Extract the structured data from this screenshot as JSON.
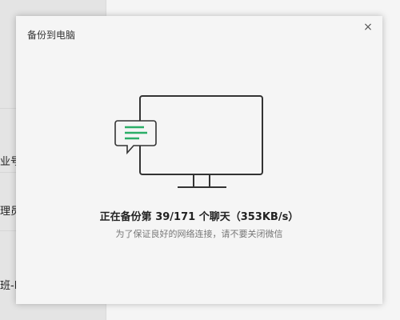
{
  "background": {
    "sidebar_items": [
      "业号",
      "理员",
      "班-I"
    ]
  },
  "dialog": {
    "title": "备份到电脑",
    "close_symbol": "×",
    "status_text": "正在备份第 39/171 个聊天（353KB/s）",
    "hint_text": "为了保证良好的网络连接，请不要关闭微信",
    "progress": {
      "current": 39,
      "total": 171,
      "speed": "353KB/s"
    }
  },
  "icons": {
    "illustration": "monitor-with-chat-bubble-icon",
    "close": "close-icon"
  },
  "colors": {
    "accent_green": "#2aae67",
    "background": "#f5f5f5"
  }
}
